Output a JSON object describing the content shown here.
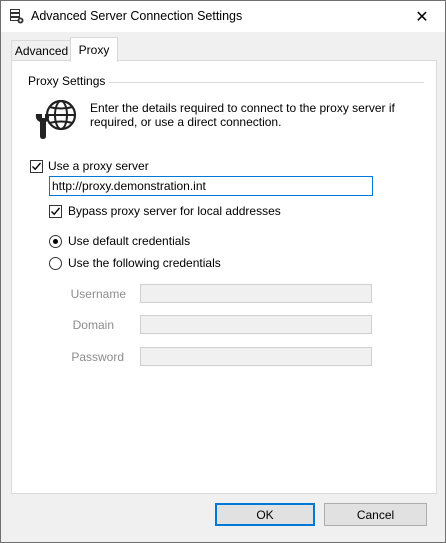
{
  "window": {
    "title": "Advanced Server Connection Settings",
    "close_glyph": "✕"
  },
  "tabs": [
    {
      "label": "Advanced",
      "selected": false
    },
    {
      "label": "Proxy",
      "selected": true
    }
  ],
  "proxy_settings": {
    "group_label": "Proxy Settings",
    "description": "Enter the details required to connect to the proxy server if required, or use a direct connection.",
    "use_proxy": {
      "label": "Use a proxy server",
      "checked": true
    },
    "proxy_address": "http://proxy.demonstration.int",
    "bypass_local": {
      "label": "Bypass proxy server for local addresses",
      "checked": true
    },
    "credentials_mode": [
      {
        "label": "Use default credentials",
        "selected": true
      },
      {
        "label": "Use the following credentials",
        "selected": false
      }
    ],
    "fields": {
      "username_label": "Username",
      "username_value": "",
      "domain_label": "Domain",
      "domain_value": "",
      "password_label": "Password",
      "password_value": ""
    }
  },
  "buttons": {
    "ok": "OK",
    "cancel": "Cancel"
  },
  "colors": {
    "accent": "#0078d7",
    "disabled_text": "#8d8d8d"
  },
  "icons": [
    "server-settings-icon",
    "globe-wrench-icon",
    "close-icon",
    "checkmark-icon"
  ]
}
